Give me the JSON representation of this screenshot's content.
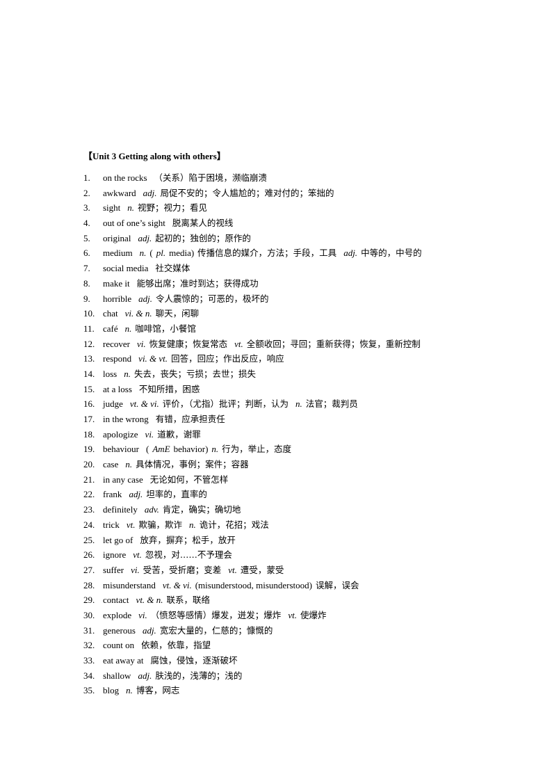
{
  "document": {
    "title": "【Unit 3 Getting along with others】",
    "entries": [
      {
        "num": "1.",
        "word": "on the rocks",
        "segments": [
          {
            "type": "cn",
            "text": "（关系）陷于困境，濒临崩溃"
          }
        ]
      },
      {
        "num": "2.",
        "word": "awkward",
        "segments": [
          {
            "type": "pos",
            "text": "adj."
          },
          {
            "type": "cn",
            "text": "局促不安的；令人尴尬的；难对付的；笨拙的"
          }
        ]
      },
      {
        "num": "3.",
        "word": "sight",
        "segments": [
          {
            "type": "pos",
            "text": "n."
          },
          {
            "type": "cn",
            "text": "视野；视力；看见"
          }
        ]
      },
      {
        "num": "4.",
        "word": "out of one’s sight",
        "segments": [
          {
            "type": "cn",
            "text": "脱离某人的视线"
          }
        ]
      },
      {
        "num": "5.",
        "word": "original",
        "segments": [
          {
            "type": "pos",
            "text": "adj."
          },
          {
            "type": "cn",
            "text": "起初的；独创的；原作的"
          }
        ]
      },
      {
        "num": "6.",
        "word": "medium",
        "segments": [
          {
            "type": "pos",
            "text": "n."
          },
          {
            "type": "plain",
            "text": "("
          },
          {
            "type": "pos",
            "text": "pl."
          },
          {
            "type": "plain",
            "text": "media)"
          },
          {
            "type": "cn",
            "text": "传播信息的媒介，方法；手段，工具"
          },
          {
            "type": "pos",
            "text": "adj."
          },
          {
            "type": "cn",
            "text": "中等的，中号的"
          }
        ]
      },
      {
        "num": "7.",
        "word": "social media",
        "segments": [
          {
            "type": "cn",
            "text": "社交媒体"
          }
        ]
      },
      {
        "num": "8.",
        "word": "make it",
        "segments": [
          {
            "type": "cn",
            "text": "能够出席；准时到达；获得成功"
          }
        ]
      },
      {
        "num": "9.",
        "word": "horrible",
        "segments": [
          {
            "type": "pos",
            "text": "adj."
          },
          {
            "type": "cn",
            "text": "令人震惊的；可恶的，极坏的"
          }
        ]
      },
      {
        "num": "10.",
        "word": "chat",
        "segments": [
          {
            "type": "pos",
            "text": "vi. & n."
          },
          {
            "type": "cn",
            "text": "聊天，闲聊"
          }
        ]
      },
      {
        "num": "11.",
        "word": "café",
        "segments": [
          {
            "type": "pos",
            "text": "n."
          },
          {
            "type": "cn",
            "text": "咖啡馆，小餐馆"
          }
        ]
      },
      {
        "num": "12.",
        "word": "recover",
        "segments": [
          {
            "type": "pos",
            "text": "vi."
          },
          {
            "type": "cn",
            "text": "恢复健康；恢复常态"
          },
          {
            "type": "pos",
            "text": "vt."
          },
          {
            "type": "cn",
            "text": "全额收回；寻回；重新获得；恢复，重新控制"
          }
        ]
      },
      {
        "num": "13.",
        "word": "respond",
        "segments": [
          {
            "type": "pos",
            "text": "vi. & vt."
          },
          {
            "type": "cn",
            "text": "回答，回应；作出反应，响应"
          }
        ]
      },
      {
        "num": "14.",
        "word": "loss",
        "segments": [
          {
            "type": "pos",
            "text": "n."
          },
          {
            "type": "cn",
            "text": "失去，丧失；亏损；去世；损失"
          }
        ]
      },
      {
        "num": "15.",
        "word": "at a loss",
        "segments": [
          {
            "type": "cn",
            "text": "不知所措，困惑"
          }
        ]
      },
      {
        "num": "16.",
        "word": "judge",
        "segments": [
          {
            "type": "pos",
            "text": "vt. & vi."
          },
          {
            "type": "cn",
            "text": "评价，（尤指）批评；判断，认为"
          },
          {
            "type": "pos",
            "text": "n."
          },
          {
            "type": "cn",
            "text": "法官；裁判员"
          }
        ]
      },
      {
        "num": "17.",
        "word": "in the wrong",
        "segments": [
          {
            "type": "cn",
            "text": "有错，应承担责任"
          }
        ]
      },
      {
        "num": "18.",
        "word": "apologize",
        "segments": [
          {
            "type": "pos",
            "text": "vi."
          },
          {
            "type": "cn",
            "text": "道歉，谢罪"
          }
        ]
      },
      {
        "num": "19.",
        "word": "behaviour",
        "segments": [
          {
            "type": "plain",
            "text": "("
          },
          {
            "type": "pos",
            "text": "AmE"
          },
          {
            "type": "plain",
            "text": "behavior)"
          },
          {
            "type": "pos",
            "text": "n."
          },
          {
            "type": "cn",
            "text": "行为，举止，态度"
          }
        ]
      },
      {
        "num": "20.",
        "word": "case",
        "segments": [
          {
            "type": "pos",
            "text": "n."
          },
          {
            "type": "cn",
            "text": "具体情况，事例；案件；容器"
          }
        ]
      },
      {
        "num": "21.",
        "word": "in any case",
        "segments": [
          {
            "type": "cn",
            "text": "无论如何，不管怎样"
          }
        ]
      },
      {
        "num": "22.",
        "word": "frank",
        "segments": [
          {
            "type": "pos",
            "text": "adj."
          },
          {
            "type": "cn",
            "text": "坦率的，直率的"
          }
        ]
      },
      {
        "num": "23.",
        "word": "definitely",
        "segments": [
          {
            "type": "pos",
            "text": "adv."
          },
          {
            "type": "cn",
            "text": "肯定，确实；确切地"
          }
        ]
      },
      {
        "num": "24.",
        "word": "trick",
        "segments": [
          {
            "type": "pos",
            "text": "vt."
          },
          {
            "type": "cn",
            "text": "欺骗，欺诈"
          },
          {
            "type": "pos",
            "text": "n."
          },
          {
            "type": "cn",
            "text": "诡计，花招；戏法"
          }
        ]
      },
      {
        "num": "25.",
        "word": "let go of",
        "segments": [
          {
            "type": "cn",
            "text": "放弃，摒弃；松手，放开"
          }
        ]
      },
      {
        "num": "26.",
        "word": "ignore",
        "segments": [
          {
            "type": "pos",
            "text": "vt."
          },
          {
            "type": "cn",
            "text": "忽视，对……不予理会"
          }
        ]
      },
      {
        "num": "27.",
        "word": "suffer",
        "segments": [
          {
            "type": "pos",
            "text": "vi."
          },
          {
            "type": "cn",
            "text": "受苦，受折磨；变差"
          },
          {
            "type": "pos",
            "text": "vt."
          },
          {
            "type": "cn",
            "text": "遭受，蒙受"
          }
        ]
      },
      {
        "num": "28.",
        "word": "misunderstand",
        "segments": [
          {
            "type": "pos",
            "text": "vt. & vi."
          },
          {
            "type": "plain",
            "text": "(misunderstood, misunderstood)"
          },
          {
            "type": "cn",
            "text": "误解，误会"
          }
        ]
      },
      {
        "num": "29.",
        "word": "contact",
        "segments": [
          {
            "type": "pos",
            "text": "vt. & n."
          },
          {
            "type": "cn",
            "text": "联系，联络"
          }
        ]
      },
      {
        "num": "30.",
        "word": "explode",
        "segments": [
          {
            "type": "pos",
            "text": "vi."
          },
          {
            "type": "cn",
            "text": "（愤怒等感情）爆发，迸发；爆炸"
          },
          {
            "type": "pos",
            "text": "vt."
          },
          {
            "type": "cn",
            "text": "使爆炸"
          }
        ]
      },
      {
        "num": "31.",
        "word": "generous",
        "segments": [
          {
            "type": "pos",
            "text": "adj."
          },
          {
            "type": "cn",
            "text": "宽宏大量的，仁慈的；慷慨的"
          }
        ]
      },
      {
        "num": "32.",
        "word": "count on",
        "segments": [
          {
            "type": "cn",
            "text": "依赖，依靠，指望"
          }
        ]
      },
      {
        "num": "33.",
        "word": "eat away at",
        "segments": [
          {
            "type": "cn",
            "text": "腐蚀，侵蚀，逐渐破坏"
          }
        ]
      },
      {
        "num": "34.",
        "word": "shallow",
        "segments": [
          {
            "type": "pos",
            "text": "adj."
          },
          {
            "type": "cn",
            "text": "肤浅的，浅薄的；浅的"
          }
        ]
      },
      {
        "num": "35.",
        "word": "blog",
        "segments": [
          {
            "type": "pos",
            "text": "n."
          },
          {
            "type": "cn",
            "text": "博客，网志"
          }
        ]
      }
    ]
  }
}
